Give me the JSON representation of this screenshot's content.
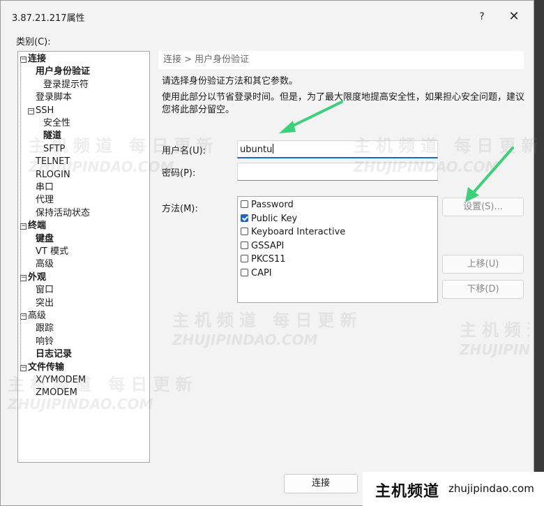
{
  "window": {
    "title": "3.87.21.217属性",
    "help_glyph": "?",
    "close_glyph": "✕"
  },
  "category_label": "类别(C):",
  "tree": {
    "nodes": [
      {
        "label": "连接",
        "bold": true
      },
      {
        "label": "用户身份验证",
        "bold": true
      },
      {
        "label": "登录提示符",
        "bold": false
      },
      {
        "label": "登录脚本",
        "bold": false
      },
      {
        "label": "SSH",
        "bold": false
      },
      {
        "label": "安全性",
        "bold": false
      },
      {
        "label": "隧道",
        "bold": true
      },
      {
        "label": "SFTP",
        "bold": false
      },
      {
        "label": "TELNET",
        "bold": false
      },
      {
        "label": "RLOGIN",
        "bold": false
      },
      {
        "label": "串口",
        "bold": false
      },
      {
        "label": "代理",
        "bold": false
      },
      {
        "label": "保持活动状态",
        "bold": false
      },
      {
        "label": "终端",
        "bold": true
      },
      {
        "label": "键盘",
        "bold": true
      },
      {
        "label": "VT 模式",
        "bold": false
      },
      {
        "label": "高级",
        "bold": false
      },
      {
        "label": "外观",
        "bold": true
      },
      {
        "label": "窗口",
        "bold": false
      },
      {
        "label": "突出",
        "bold": false
      },
      {
        "label": "高级",
        "bold": false
      },
      {
        "label": "跟踪",
        "bold": false
      },
      {
        "label": "响铃",
        "bold": false
      },
      {
        "label": "日志记录",
        "bold": true
      },
      {
        "label": "文件传输",
        "bold": true
      },
      {
        "label": "X/YMODEM",
        "bold": false
      },
      {
        "label": "ZMODEM",
        "bold": false
      }
    ],
    "selected": "用户身份验证"
  },
  "panel": {
    "header": "连接 > 用户身份验证",
    "desc1": "请选择身份验证方法和其它参数。",
    "desc2": "使用此部分以节省登录时间。但是，为了最大限度地提高安全性，如果担心安全问题，建议您将此部分留空。",
    "username_label": "用户名(U):",
    "username_value": "ubuntu",
    "password_label": "密码(P):",
    "password_value": "",
    "method_label": "方法(M):",
    "methods": [
      {
        "label": "Password",
        "checked": false
      },
      {
        "label": "Public Key",
        "checked": true
      },
      {
        "label": "Keyboard Interactive",
        "checked": false
      },
      {
        "label": "GSSAPI",
        "checked": false
      },
      {
        "label": "PKCS11",
        "checked": false
      },
      {
        "label": "CAPI",
        "checked": false
      }
    ],
    "settings_button": "设置(S)...",
    "move_up_button": "上移(U)",
    "move_down_button": "下移(D)"
  },
  "connect_button": "连接",
  "watermark": {
    "cn": "主机频道 每日更新",
    "en": "ZHUJIPINDAO.COM"
  },
  "brand": {
    "cn": "主机频道",
    "en": "zhujipindao.com"
  },
  "colors": {
    "accent": "#1d65c1",
    "arrow": "#3ecf7a"
  }
}
